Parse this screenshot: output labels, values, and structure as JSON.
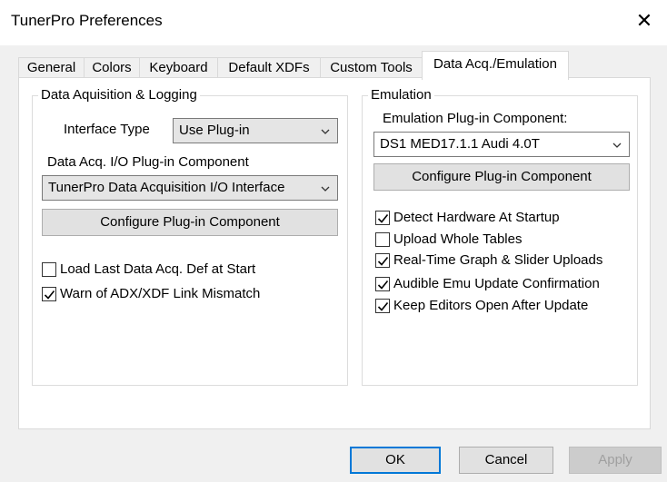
{
  "window": {
    "title": "TunerPro Preferences",
    "close_glyph": "✕"
  },
  "tabs": [
    "General",
    "Colors",
    "Keyboard",
    "Default XDFs",
    "Custom Tools",
    "Data Acq./Emulation"
  ],
  "data_acq": {
    "group_title": "Data Aquisition & Logging",
    "interface_type_label": "Interface Type",
    "interface_type_value": "Use Plug-in",
    "plugin_label": "Data Acq. I/O Plug-in Component",
    "plugin_value": "TunerPro Data Acquisition I/O Interface",
    "configure_button": "Configure Plug-in Component",
    "checkboxes": [
      {
        "label": "Load Last Data Acq. Def at Start",
        "checked": false
      },
      {
        "label": "Warn of ADX/XDF Link Mismatch",
        "checked": true
      }
    ]
  },
  "emulation": {
    "group_title": "Emulation",
    "plugin_label": "Emulation Plug-in Component:",
    "plugin_value": "DS1 MED17.1.1 Audi 4.0T",
    "configure_button": "Configure Plug-in Component",
    "checkboxes": [
      {
        "label": "Detect Hardware At Startup",
        "checked": true
      },
      {
        "label": "Upload Whole Tables",
        "checked": false
      },
      {
        "label": "Real-Time Graph & Slider Uploads",
        "checked": true
      },
      {
        "label": "Audible Emu Update Confirmation",
        "checked": true
      },
      {
        "label": "Keep Editors Open After Update",
        "checked": true
      }
    ]
  },
  "footer": {
    "ok": "OK",
    "cancel": "Cancel",
    "apply": "Apply",
    "apply_enabled": false
  },
  "colors": {
    "accent": "#0078d7",
    "disabled_text": "#a0a0a0"
  }
}
